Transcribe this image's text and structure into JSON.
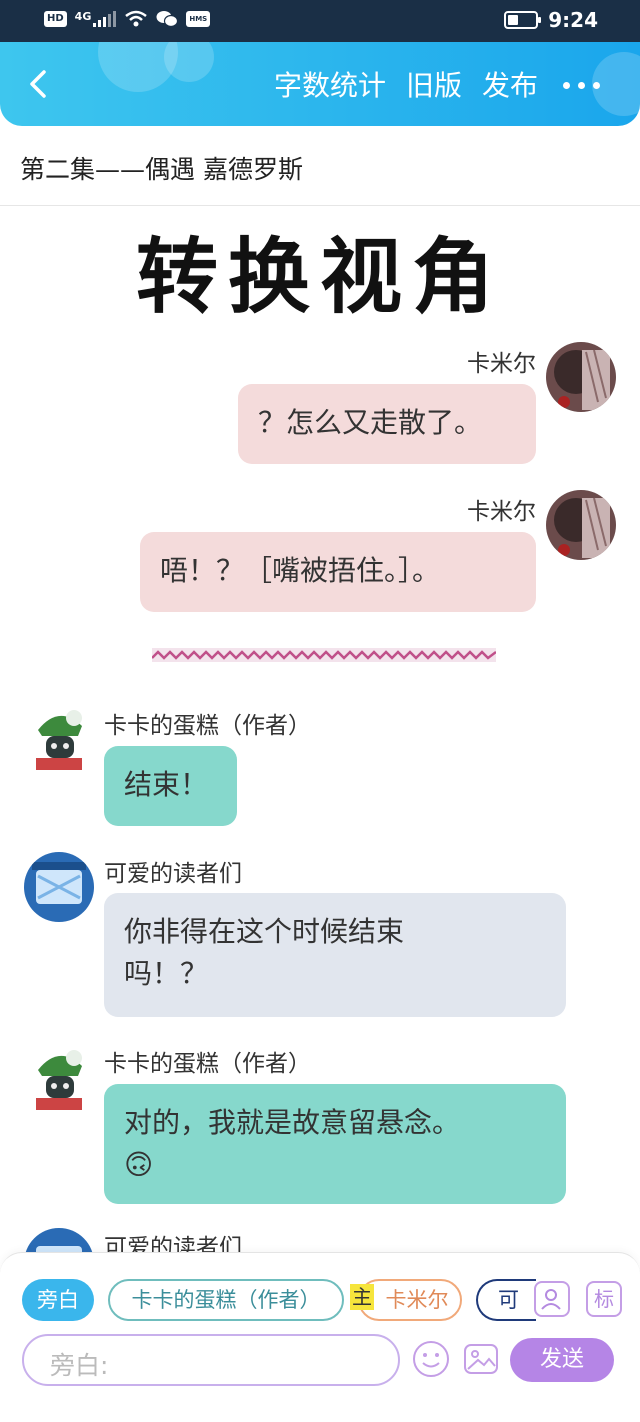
{
  "status_bar": {
    "hd": "HD",
    "net": "4G",
    "hms": "HMS",
    "time": "9:24"
  },
  "header": {
    "actions": [
      "字数统计",
      "旧版",
      "发布"
    ]
  },
  "chapter": {
    "title": "第二集——偶遇  嘉德罗斯"
  },
  "big_title": "转换视角",
  "messages": [
    {
      "name": "卡米尔",
      "text": "？怎么又走散了。"
    },
    {
      "name": "卡米尔",
      "text": "唔！？［嘴被捂住。］。"
    },
    {
      "name": "卡卡的蛋糕（作者）",
      "text": "结束！"
    },
    {
      "name": "可爱的读者们",
      "text_line1": "你非得在这个时候结束",
      "text_line2": "吗！？"
    },
    {
      "name": "卡卡的蛋糕（作者）",
      "text": "对的，我就是故意留悬念。",
      "emoji": "🙃"
    },
    {
      "name": "可爱的读者们"
    }
  ],
  "roles": {
    "narration": "旁白",
    "author": "卡卡的蛋糕（作者）",
    "main_tag": "主",
    "kamier": "卡米尔",
    "reader": "可"
  },
  "icons": {
    "label_button": "标"
  },
  "input": {
    "placeholder": "旁白:"
  },
  "send_label": "发送",
  "colors": {
    "header": "#1aa6ec",
    "pink_bubble": "#f4dbdb",
    "teal_bubble": "#86d8cc",
    "grey_bubble": "#e1e6ee",
    "send": "#b585e6"
  }
}
